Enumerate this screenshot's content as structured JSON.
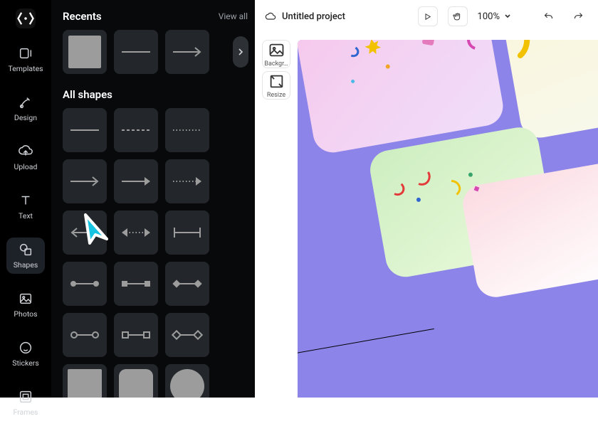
{
  "rail": {
    "items": [
      {
        "id": "templates",
        "label": "Templates"
      },
      {
        "id": "design",
        "label": "Design"
      },
      {
        "id": "upload",
        "label": "Upload"
      },
      {
        "id": "text",
        "label": "Text"
      },
      {
        "id": "shapes",
        "label": "Shapes"
      },
      {
        "id": "photos",
        "label": "Photos"
      },
      {
        "id": "stickers",
        "label": "Stickers"
      },
      {
        "id": "frames",
        "label": "Frames"
      }
    ]
  },
  "panel": {
    "recents_title": "Recents",
    "view_all": "View all",
    "all_shapes_title": "All shapes"
  },
  "topbar": {
    "project_name": "Untitled project",
    "zoom": "100%"
  },
  "canvas_tools": {
    "background_label": "Backgr…",
    "resize_label": "Resize"
  }
}
